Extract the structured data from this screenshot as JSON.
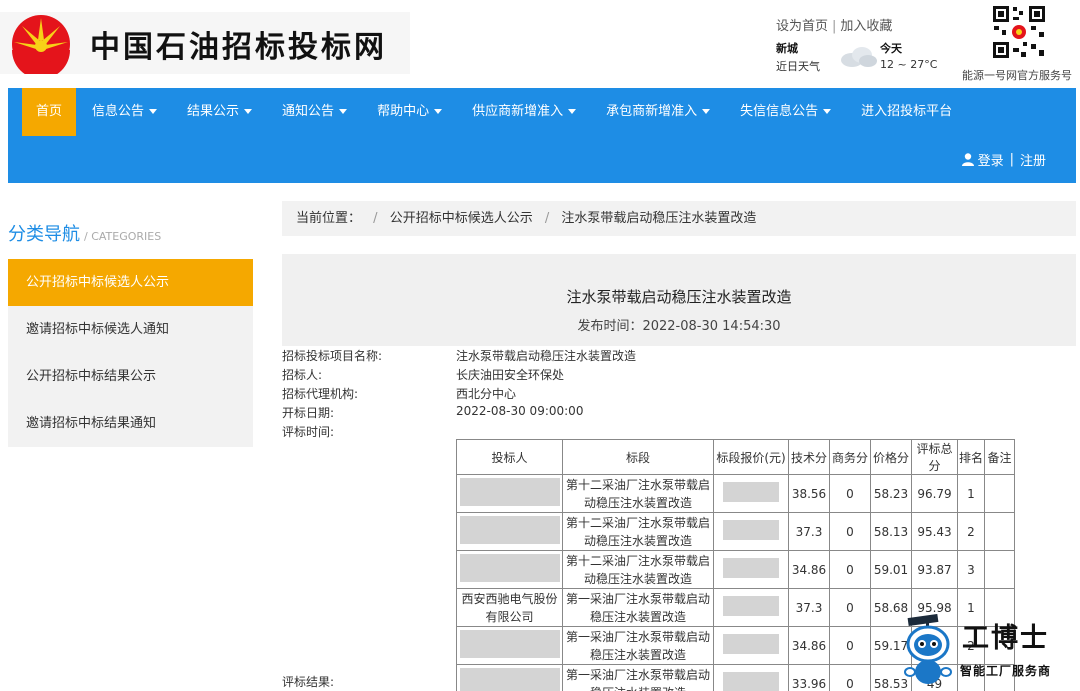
{
  "header": {
    "site_title": "中国石油招标投标网",
    "set_home": "设为首页",
    "add_favorite": "加入收藏",
    "weather": {
      "city": "新城",
      "label": "近日天气",
      "day": "今天",
      "temp": "12 ~ 27°C"
    },
    "qr_caption": "能源一号网官方服务号"
  },
  "nav": {
    "items": [
      {
        "label": "首页",
        "dropdown": false,
        "active": true
      },
      {
        "label": "信息公告",
        "dropdown": true
      },
      {
        "label": "结果公示",
        "dropdown": true
      },
      {
        "label": "通知公告",
        "dropdown": true
      },
      {
        "label": "帮助中心",
        "dropdown": true
      },
      {
        "label": "供应商新增准入",
        "dropdown": true
      },
      {
        "label": "承包商新增准入",
        "dropdown": true
      },
      {
        "label": "失信信息公告",
        "dropdown": true
      },
      {
        "label": "进入招投标平台",
        "dropdown": false
      }
    ],
    "login": "登录",
    "register": "注册"
  },
  "sidebar": {
    "title": "分类导航",
    "title_en": "/ CATEGORIES",
    "items": [
      {
        "label": "公开招标中标候选人公示",
        "active": true
      },
      {
        "label": "邀请招标中标候选人通知"
      },
      {
        "label": "公开招标中标结果公示"
      },
      {
        "label": "邀请招标中标结果通知"
      }
    ]
  },
  "breadcrumb": {
    "prefix": "当前位置：",
    "items": [
      "公开招标中标候选人公示",
      "注水泵带载启动稳压注水装置改造"
    ]
  },
  "article": {
    "title": "注水泵带载启动稳压注水装置改造",
    "publish_label": "发布时间：",
    "publish_time": "2022-08-30 14:54:30",
    "fields": [
      {
        "label": "招标投标项目名称:",
        "value": "注水泵带载启动稳压注水装置改造"
      },
      {
        "label": "招标人:",
        "value": "长庆油田安全环保处"
      },
      {
        "label": "招标代理机构:",
        "value": "西北分中心"
      },
      {
        "label": "开标日期:",
        "value": "2022-08-30 09:00:00"
      },
      {
        "label": "评标时间:",
        "value": ""
      }
    ],
    "result_label": "评标结果:"
  },
  "table": {
    "headers": [
      "投标人",
      "标段",
      "标段报价(元)",
      "技术分",
      "商务分",
      "价格分",
      "评标总分",
      "排名",
      "备注"
    ],
    "rows": [
      {
        "bidder": "",
        "section": "第十二采油厂注水泵带载启动稳压注水装置改造",
        "tech": "38.56",
        "biz": "0",
        "price_score": "58.23",
        "total": "96.79",
        "rank": "1"
      },
      {
        "bidder": "",
        "section": "第十二采油厂注水泵带载启动稳压注水装置改造",
        "tech": "37.3",
        "biz": "0",
        "price_score": "58.13",
        "total": "95.43",
        "rank": "2"
      },
      {
        "bidder": "",
        "section": "第十二采油厂注水泵带载启动稳压注水装置改造",
        "tech": "34.86",
        "biz": "0",
        "price_score": "59.01",
        "total": "93.87",
        "rank": "3"
      },
      {
        "bidder": "西安西驰电气股份有限公司",
        "section": "第一采油厂注水泵带载启动稳压注水装置改造",
        "tech": "37.3",
        "biz": "0",
        "price_score": "58.68",
        "total": "95.98",
        "rank": "1"
      },
      {
        "bidder": "",
        "section": "第一采油厂注水泵带载启动稳压注水装置改造",
        "tech": "34.86",
        "biz": "0",
        "price_score": "59.17",
        "total": "03",
        "rank": "2"
      },
      {
        "bidder": "",
        "section": "第一采油厂注水泵带载启动稳压注水装置改造",
        "tech": "33.96",
        "biz": "0",
        "price_score": "58.53",
        "total": "49",
        "rank": ""
      }
    ]
  },
  "watermark": {
    "name": "工博士",
    "sub": "智能工厂服务商"
  },
  "colors": {
    "nav_blue": "#1e8de5",
    "accent_orange": "#f5a800"
  }
}
